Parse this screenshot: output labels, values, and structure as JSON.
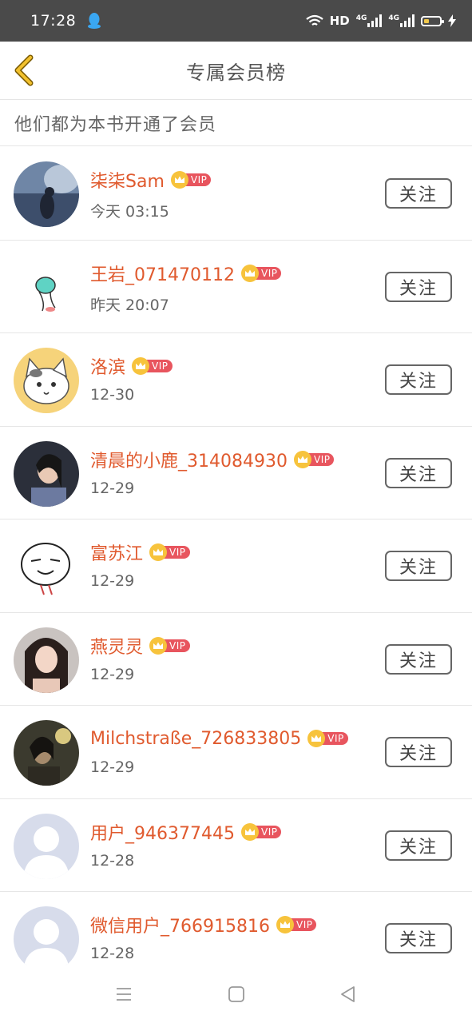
{
  "status": {
    "time": "17:28",
    "hd": "HD",
    "net1": "4G",
    "net2": "4G"
  },
  "header": {
    "title": "专属会员榜"
  },
  "subtitle": "他们都为本书开通了会员",
  "vip_label": "VIP",
  "follow_label": "关注",
  "members": [
    {
      "name": "柒柒Sam",
      "time": "今天 03:15"
    },
    {
      "name": "王岩_071470112",
      "time": "昨天 20:07"
    },
    {
      "name": "洛滨",
      "time": "12-30"
    },
    {
      "name": "清晨的小鹿_314084930",
      "time": "12-29"
    },
    {
      "name": "富苏江",
      "time": "12-29"
    },
    {
      "name": "燕灵灵",
      "time": "12-29"
    },
    {
      "name": "Milchstraße_726833805",
      "time": "12-29"
    },
    {
      "name": "用户_946377445",
      "time": "12-28"
    },
    {
      "name": "微信用户_766915816",
      "time": "12-28"
    }
  ],
  "colors": {
    "name": "#e05a2e",
    "vip_tag": "#e8555e",
    "crown": "#f7c33c",
    "back_arrow": "#e6b422"
  }
}
